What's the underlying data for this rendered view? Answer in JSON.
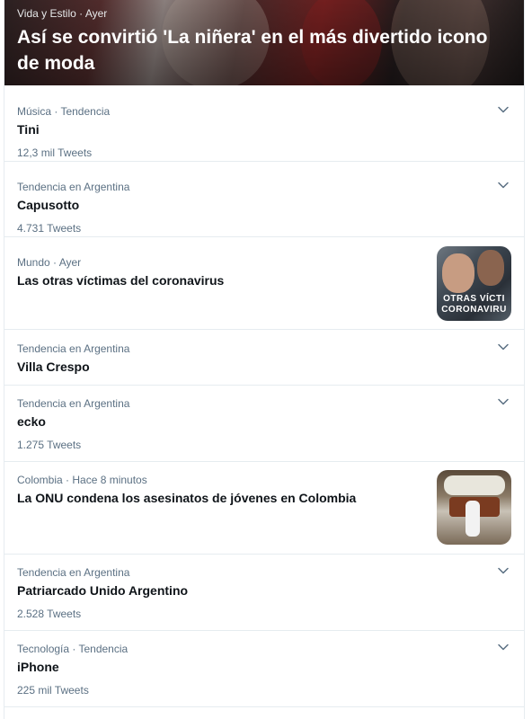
{
  "hero": {
    "meta": "Vida y Estilo · Ayer",
    "title": "Así se convirtió 'La niñera' en el más divertido icono de moda"
  },
  "trends": [
    {
      "category": "Música · Tendencia",
      "name": "Tini",
      "count": "12,3 mil Tweets",
      "has_chevron": true
    },
    {
      "category": "Tendencia en Argentina",
      "name": "Capusotto",
      "count": "4.731 Tweets",
      "has_chevron": true
    },
    {
      "category": "Mundo · Ayer",
      "name": "Las otras víctimas del coronavirus",
      "thumb_caption": [
        "OTRAS VÍCTI",
        "CORONAVIRU"
      ],
      "has_chevron": false
    },
    {
      "category": "Tendencia en Argentina",
      "name": "Villa Crespo",
      "has_chevron": true
    },
    {
      "category": "Tendencia en Argentina",
      "name": "ecko",
      "count": "1.275 Tweets",
      "has_chevron": true
    },
    {
      "category": "Colombia · Hace 8 minutos",
      "name": "La ONU condena los asesinatos de jóvenes en Colombia",
      "has_chevron": false
    },
    {
      "category": "Tendencia en Argentina",
      "name": "Patriarcado Unido Argentino",
      "count": "2.528 Tweets",
      "has_chevron": true
    },
    {
      "category": "Tecnología · Tendencia",
      "name": "iPhone",
      "count": "225 mil Tweets",
      "has_chevron": true
    }
  ],
  "icons": {
    "chevron": "chevron-down-icon"
  },
  "colors": {
    "secondary_text": "#5b7083",
    "divider": "#e6ecf0",
    "primary_text": "#0f1419"
  }
}
